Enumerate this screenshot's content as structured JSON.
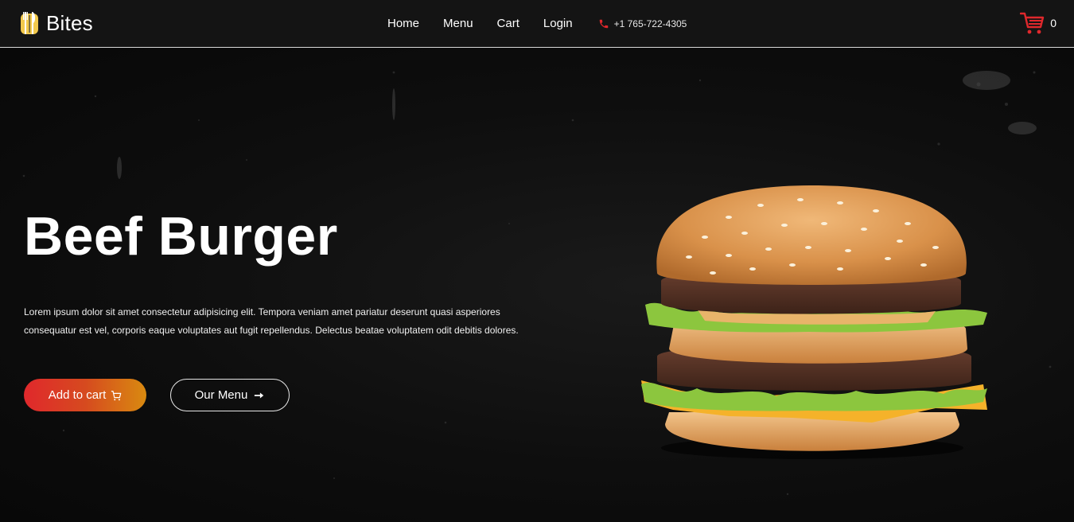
{
  "brand": {
    "name": "Bites",
    "logo_icon": "fork-knife-logo-icon"
  },
  "nav": {
    "links": [
      "Home",
      "Menu",
      "Cart",
      "Login"
    ],
    "phone": "+1 765-722-4305",
    "phone_icon": "phone-icon"
  },
  "cart": {
    "count": "0",
    "icon": "cart-icon"
  },
  "hero": {
    "title": "Beef Burger",
    "description": "Lorem ipsum dolor sit amet consectetur adipisicing elit. Tempora veniam amet pariatur deserunt quasi asperiores consequatur est vel, corporis eaque voluptates aut fugit repellendus. Delectus beatae voluptatem odit debitis dolores.",
    "add_to_cart_label": "Add to cart",
    "our_menu_label": "Our Menu",
    "image": "beef-burger-image"
  },
  "colors": {
    "accent_red": "#e0282c",
    "accent_orange": "#d98a10",
    "nav_bg": "#141414",
    "hero_bg": "#0d0d0d"
  }
}
